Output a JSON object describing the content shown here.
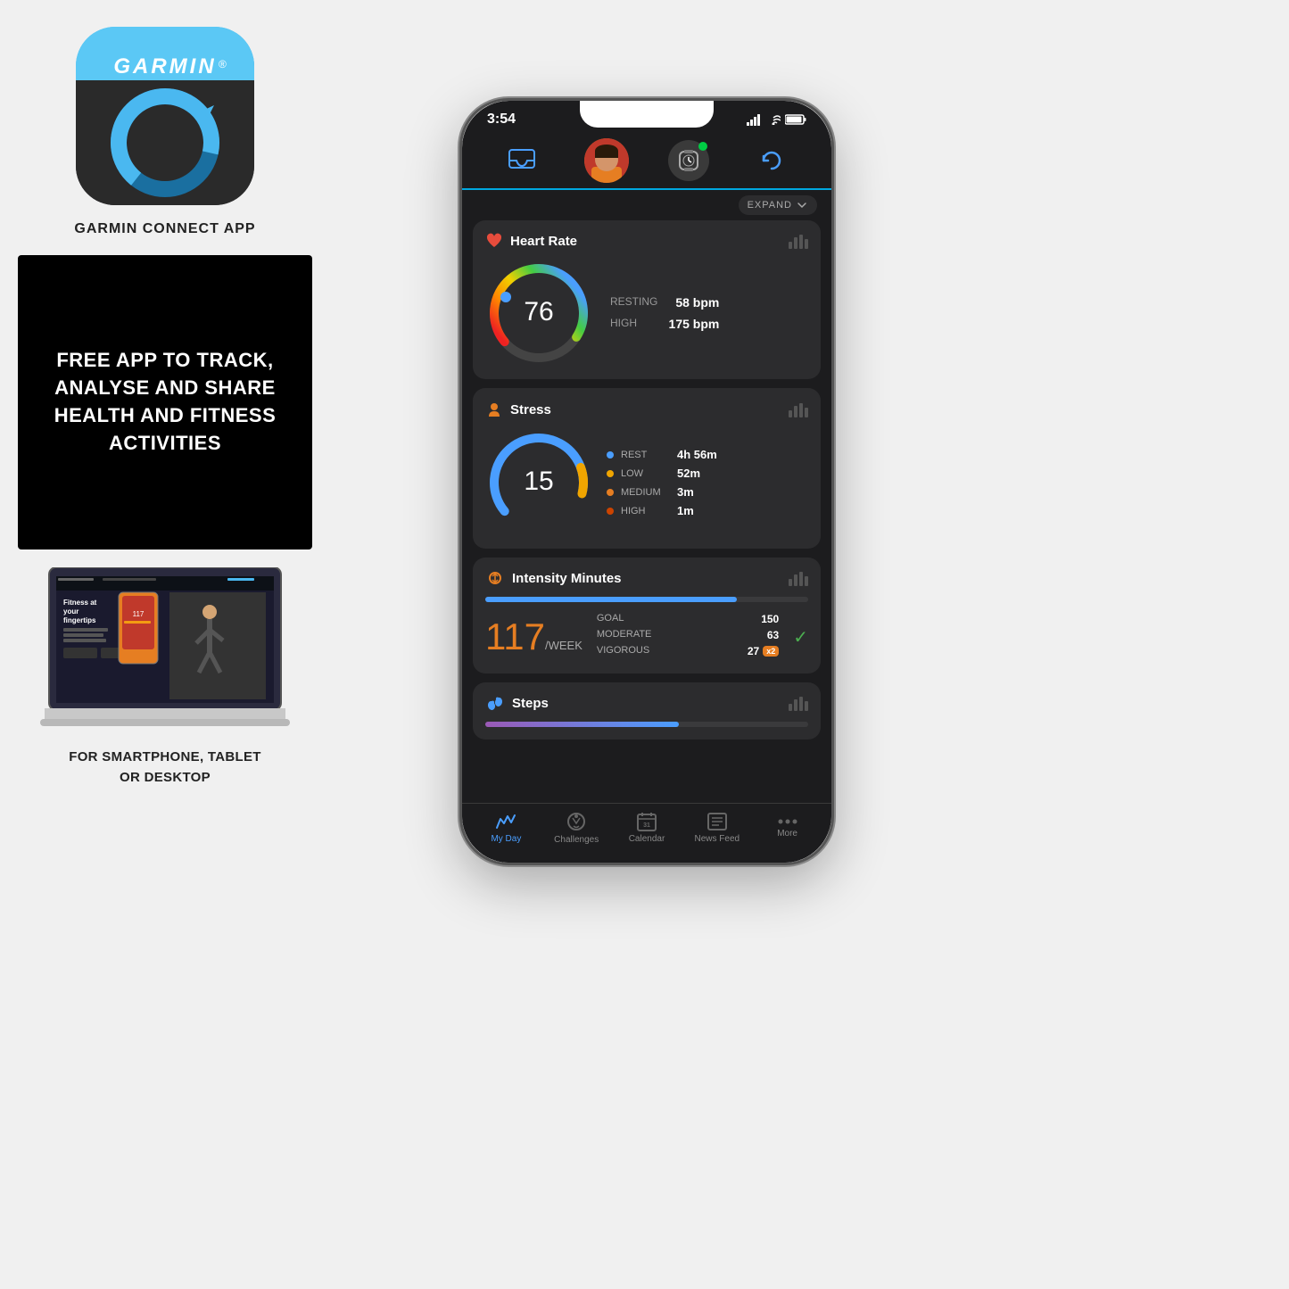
{
  "left": {
    "app_title": "GARMIN CONNECT APP",
    "garmin_text": "GARMIN®",
    "black_panel_text": "FREE APP TO TRACK, ANALYSE AND SHARE HEALTH AND FITNESS ACTIVITIES",
    "laptop_subtitle": "FOR SMARTPHONE, TABLET\nOR DESKTOP"
  },
  "phone": {
    "status_time": "3:54",
    "expand_label": "EXPAND",
    "heart_rate": {
      "title": "Heart Rate",
      "value": "76",
      "resting_label": "RESTING",
      "resting_value": "58 bpm",
      "high_label": "HIGH",
      "high_value": "175 bpm"
    },
    "stress": {
      "title": "Stress",
      "value": "15",
      "rest_label": "REST",
      "rest_value": "4h 56m",
      "low_label": "LOW",
      "low_value": "52m",
      "medium_label": "MEDIUM",
      "medium_value": "3m",
      "high_label": "HIGH",
      "high_value": "1m"
    },
    "intensity": {
      "title": "Intensity Minutes",
      "big_number": "117",
      "week_label": "/WEEK",
      "goal_label": "GOAL",
      "goal_value": "150",
      "moderate_label": "MODERATE",
      "moderate_value": "63",
      "vigorous_label": "VIGOROUS",
      "vigorous_value": "27",
      "x2_label": "x2"
    },
    "steps": {
      "title": "Steps"
    },
    "tabs": {
      "my_day": "My Day",
      "challenges": "Challenges",
      "calendar": "Calendar",
      "news_feed": "News Feed",
      "more": "More"
    }
  },
  "colors": {
    "accent_blue": "#4a9eff",
    "accent_orange": "#e67e22",
    "accent_green": "#4caf50",
    "garmin_blue": "#00a8e0"
  }
}
